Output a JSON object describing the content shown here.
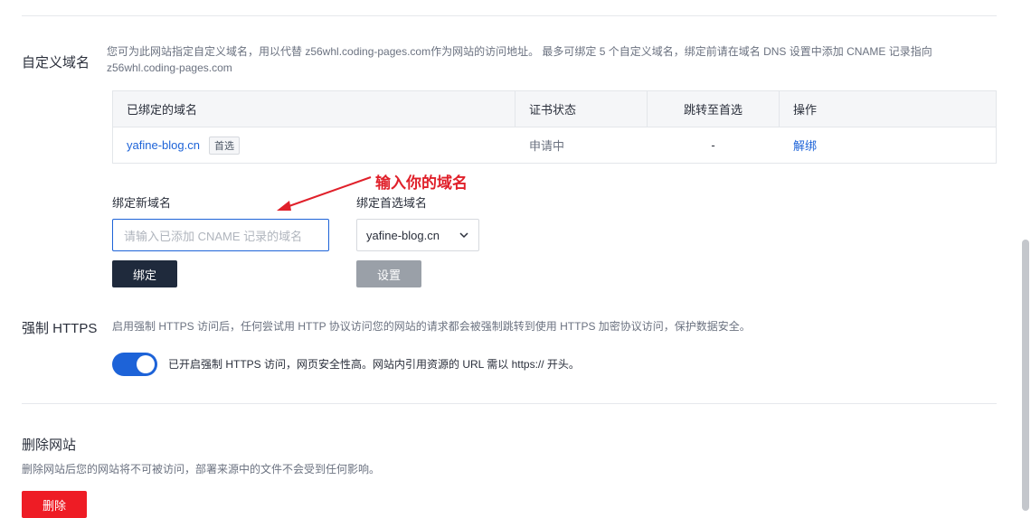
{
  "custom_domain": {
    "title": "自定义域名",
    "description_line1": "您可为此网站指定自定义域名，用以代替 z56whl.coding-pages.com作为网站的访问地址。 最多可绑定 5 个自定义域名，绑定前请在域名 DNS 设置中添加 CNAME 记录指向",
    "description_line2": "z56whl.coding-pages.com",
    "table": {
      "headers": [
        "已绑定的域名",
        "证书状态",
        "跳转至首选",
        "操作"
      ],
      "rows": [
        {
          "domain": "yafine-blog.cn",
          "tag": "首选",
          "cert_status": "申请中",
          "redirect": "-",
          "action": "解绑"
        }
      ]
    },
    "bind_new": {
      "label": "绑定新域名",
      "placeholder": "请输入已添加 CNAME 记录的域名",
      "button": "绑定"
    },
    "preferred": {
      "label": "绑定首选域名",
      "selected": "yafine-blog.cn",
      "button": "设置"
    },
    "annotation": "输入你的域名"
  },
  "force_https": {
    "title": "强制 HTTPS",
    "description": "启用强制 HTTPS 访问后，任何尝试用 HTTP 协议访问您的网站的请求都会被强制跳转到使用 HTTPS 加密协议访问，保护数据安全。",
    "toggle_on": true,
    "toggle_text": "已开启强制 HTTPS 访问，网页安全性高。网站内引用资源的 URL 需以 https:// 开头。"
  },
  "delete_site": {
    "title": "删除网站",
    "description": "删除网站后您的网站将不可被访问，部署来源中的文件不会受到任何影响。",
    "button": "删除"
  },
  "colors": {
    "primary": "#1d63d8",
    "dark_button": "#1f2a3c",
    "danger": "#ee1c25",
    "annotation": "#e0202a"
  }
}
